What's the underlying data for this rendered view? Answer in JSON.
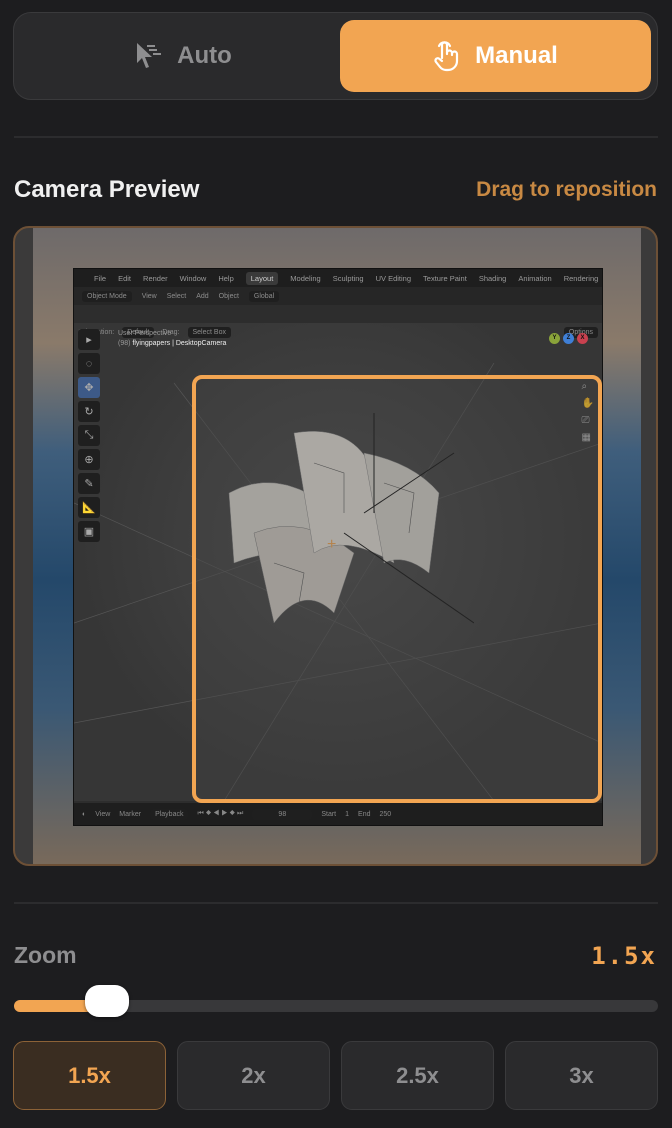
{
  "mode_toggle": {
    "options": [
      {
        "label": "Auto",
        "icon": "cursor-click-icon",
        "selected": false
      },
      {
        "label": "Manual",
        "icon": "hand-pointer-icon",
        "selected": true
      }
    ]
  },
  "preview": {
    "title": "Camera Preview",
    "hint": "Drag to reposition",
    "blender": {
      "menu": [
        "File",
        "Edit",
        "Render",
        "Window",
        "Help"
      ],
      "workspaces": [
        "Layout",
        "Modeling",
        "Sculpting",
        "UV Editing",
        "Texture Paint",
        "Shading",
        "Animation",
        "Rendering"
      ],
      "header": {
        "mode": "Object Mode",
        "items": [
          "View",
          "Select",
          "Add",
          "Object"
        ],
        "transform": "Global"
      },
      "tool_header": {
        "orientation_label": "Orientation:",
        "orientation": "Default",
        "drag_label": "Drag:",
        "drag": "Select Box",
        "options": "Options"
      },
      "viewport": {
        "perspective": "User Perspective",
        "frame_prefix": "(98)",
        "object": "flyingpapers | DesktopCamera"
      },
      "timeline": {
        "items": [
          "View",
          "Marker",
          "Playback"
        ],
        "current_frame": "98",
        "start_label": "Start",
        "start": "1",
        "end_label": "End",
        "end": "250"
      }
    }
  },
  "zoom": {
    "label": "Zoom",
    "value_display": "1.5x",
    "value": 1.5,
    "slider_fill_percent": 14.5,
    "presets": [
      {
        "label": "1.5x",
        "selected": true
      },
      {
        "label": "2x",
        "selected": false
      },
      {
        "label": "2.5x",
        "selected": false
      },
      {
        "label": "3x",
        "selected": false
      }
    ]
  },
  "colors": {
    "accent": "#f2a552",
    "background": "#1d1d1f",
    "hint": "#c88943"
  }
}
